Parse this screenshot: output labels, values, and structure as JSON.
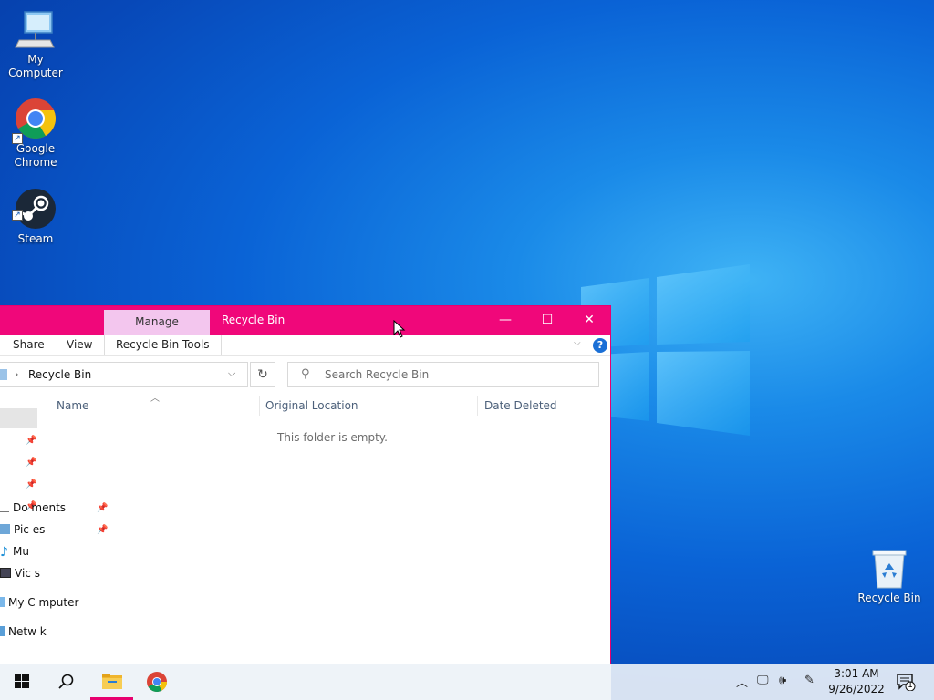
{
  "desktop": {
    "icons": [
      {
        "label": "My Computer",
        "icon": "monitor-icon"
      },
      {
        "label": "Google\nChrome",
        "icon": "chrome-icon"
      },
      {
        "label": "Steam",
        "icon": "steam-icon"
      },
      {
        "label": "Recycle Bin",
        "icon": "recycle-bin-icon"
      }
    ]
  },
  "explorer": {
    "manage_tab": "Manage",
    "title": "Recycle Bin",
    "controls": {
      "minimize": "—",
      "maximize": "☐",
      "close": "✕"
    },
    "ribbon": {
      "share": "Share",
      "view": "View",
      "tools": "Recycle Bin Tools",
      "help": "?"
    },
    "address": {
      "path": "Recycle Bin"
    },
    "search": {
      "placeholder": "Search Recycle Bin"
    },
    "columns": {
      "name": "Name",
      "original_location": "Original Location",
      "date_deleted": "Date Deleted"
    },
    "empty_message": "This folder is empty.",
    "nav": {
      "documents": "Documents",
      "pictures": "Pictures",
      "music": "Mu",
      "videos": "Vid  s",
      "my_computer": "My C  mputer",
      "network": "Netw  k"
    },
    "nav_texts": {
      "documents": "Do ments",
      "pictures": "Pic es",
      "music": "Mu",
      "videos": "Vic s",
      "my_computer": "My C mputer",
      "network": "Netw k"
    }
  },
  "taskbar": {
    "clock_time": "3:01 AM",
    "clock_date": "9/26/2022",
    "notification_count": "1",
    "accent_color": "#e8006f"
  }
}
